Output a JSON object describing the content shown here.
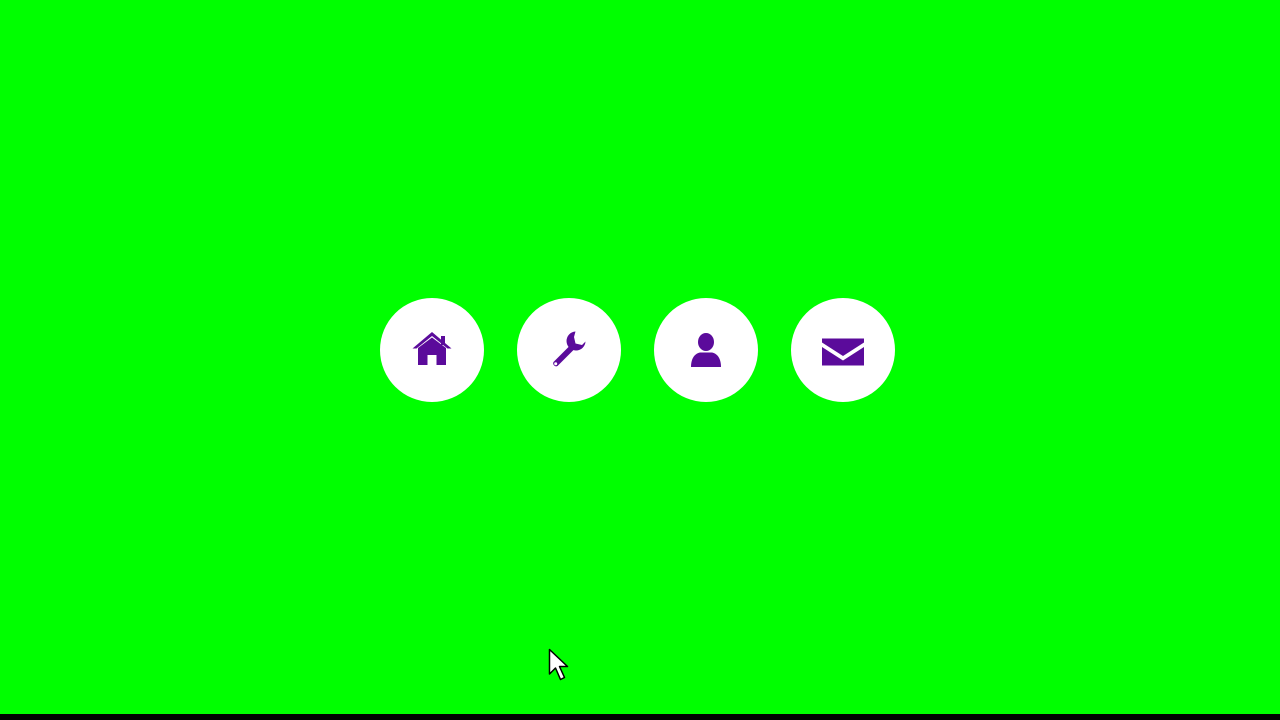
{
  "colors": {
    "background": "#00ff00",
    "button_fill": "#ffffff",
    "icon_color": "#5b0b9b",
    "bottom_bar": "#000000"
  },
  "icon_buttons": [
    {
      "icon": "home-icon"
    },
    {
      "icon": "wrench-icon"
    },
    {
      "icon": "user-icon"
    },
    {
      "icon": "envelope-icon"
    }
  ],
  "cursor": {
    "icon": "mouse-pointer-icon"
  }
}
